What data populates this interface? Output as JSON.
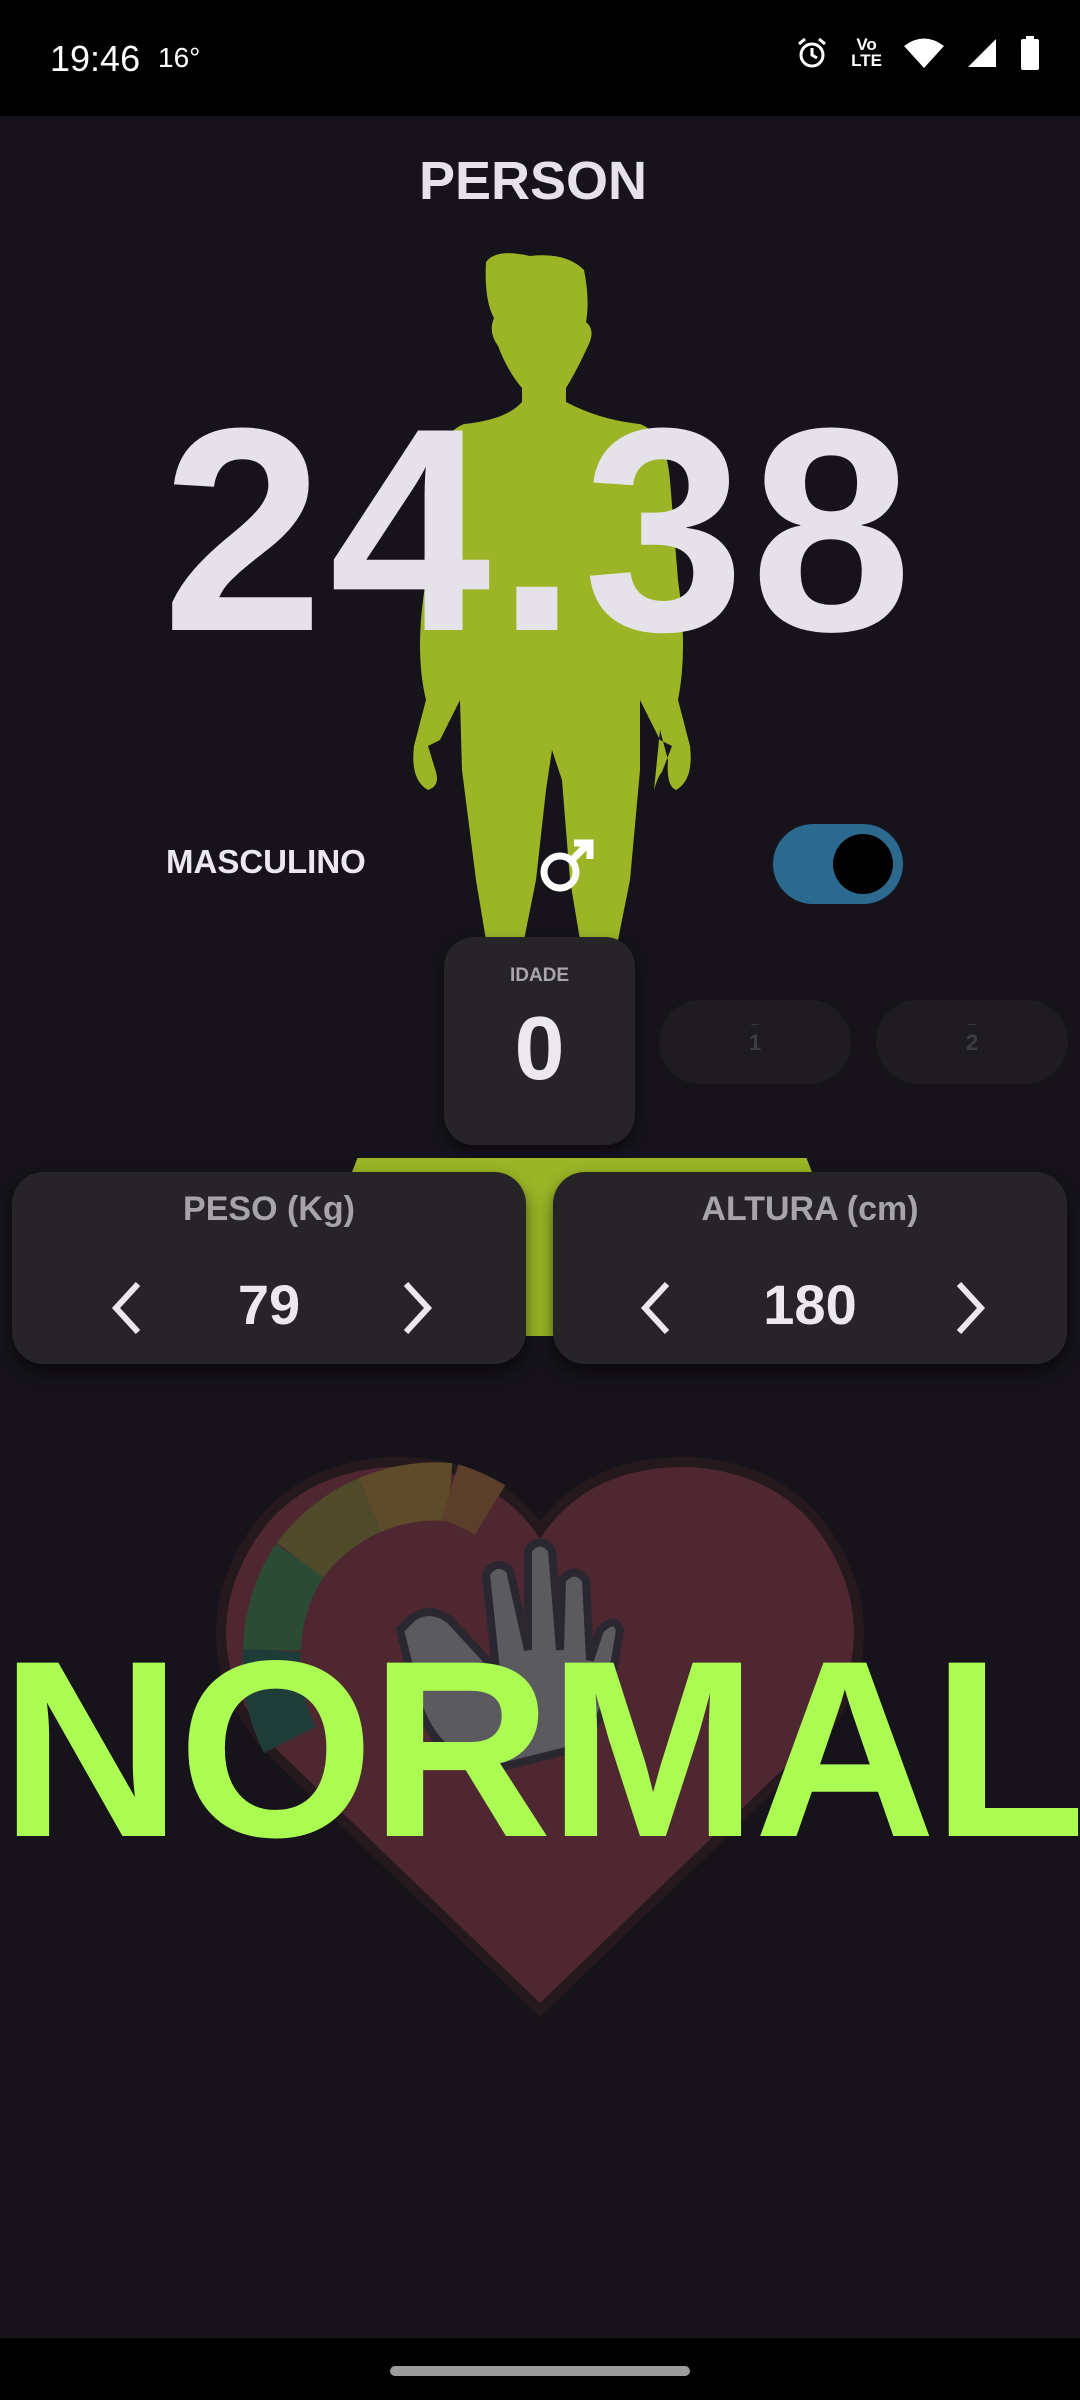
{
  "status_bar": {
    "time": "19:46",
    "temperature": "16°",
    "volte_label": "Vo\nLTE",
    "icons": [
      "alarm-icon",
      "volte-icon",
      "wifi-icon",
      "signal-icon",
      "battery-icon"
    ]
  },
  "header": {
    "title": "PERSON"
  },
  "bmi": {
    "value": "24.38"
  },
  "gender": {
    "label": "MASCULINO",
    "symbol": "♂",
    "toggle_on": true
  },
  "age": {
    "label": "IDADE",
    "value": "0",
    "options": [
      {
        "dash": "–",
        "value": "1"
      },
      {
        "dash": "–",
        "value": "2"
      }
    ]
  },
  "weight": {
    "label": "PESO (Kg)",
    "value": "79"
  },
  "height": {
    "label": "ALTURA (cm)",
    "value": "180"
  },
  "result": {
    "label": "NORMAL"
  },
  "colors": {
    "background": "#16131b",
    "figure": "#9bb526",
    "result_text": "#acfb52",
    "card": "#262427",
    "toggle_track": "#2b6a8e"
  }
}
